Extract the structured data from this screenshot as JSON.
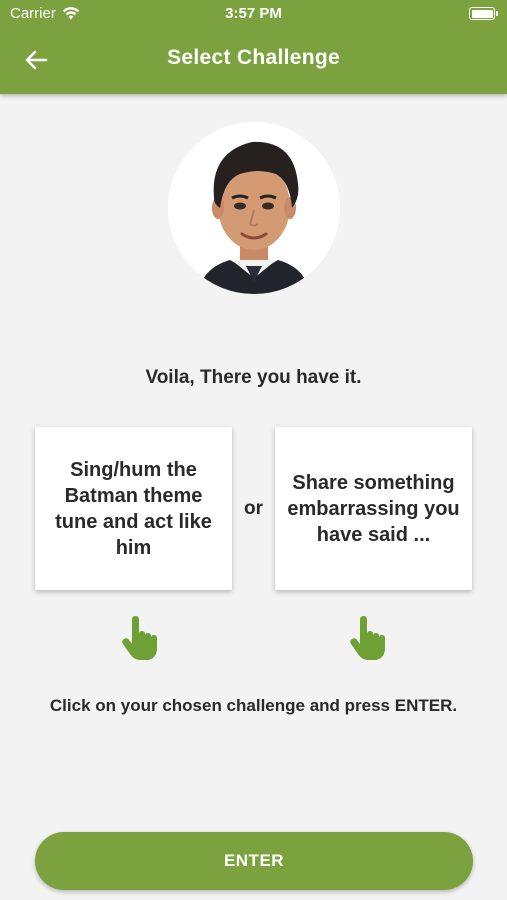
{
  "status_bar": {
    "carrier": "Carrier",
    "time": "3:57 PM"
  },
  "header": {
    "title": "Select Challenge",
    "back_icon": "arrow-left-icon",
    "background_color": "#7ba23f"
  },
  "main": {
    "message": "Voila, There you have it.",
    "challenges": [
      {
        "text": "Sing/hum the Batman theme tune and act like him"
      },
      {
        "text": "Share something embarrassing you have said ..."
      }
    ],
    "separator": "or",
    "pointer_icon": "hand-pointer-icon",
    "instruction": "Click on your chosen challenge and press ENTER."
  },
  "footer": {
    "enter_label": "ENTER"
  },
  "colors": {
    "accent": "#7ba23f",
    "background": "#f3f3f3"
  }
}
